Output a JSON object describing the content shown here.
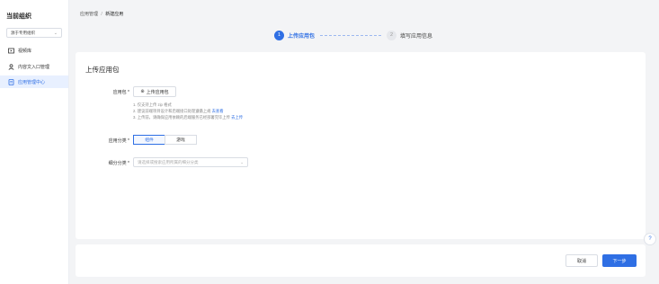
{
  "sidebar": {
    "title": "当前组织",
    "org_select": {
      "value": "源于专用组织",
      "icon": "chevron-down-icon"
    },
    "items": [
      {
        "label": "视频库",
        "icon": "video-library-icon",
        "active": false
      },
      {
        "label": "内容文入口管理",
        "icon": "user-group-icon",
        "active": false
      },
      {
        "label": "应用管理中心",
        "icon": "app-doc-icon",
        "active": true
      }
    ]
  },
  "breadcrumb": {
    "parent": "应用管理",
    "separator": "/",
    "current": "新建应用"
  },
  "steps": [
    {
      "number": "1",
      "label": "上传应用包",
      "state": "active"
    },
    {
      "number": "2",
      "label": "填写应用信息",
      "state": "inactive"
    }
  ],
  "form": {
    "title": "上传应用包",
    "package_label": "应用包 *",
    "upload_button": "上传应用包",
    "hints": {
      "h1": "1. 仅支持上传 zip 格式",
      "h2_text": "2. 建议前端项目设计和后端接口处理遵循上规",
      "h2_link": "去查看",
      "h3_text": "3. 上传前，请确保应用依赖的后端服务已经部署完毕上传",
      "h3_link": "去上传"
    },
    "category_label": "应用分类 *",
    "category_options": [
      "组件",
      "游戏"
    ],
    "category_selected": "组件",
    "subcategory_label": "细分分类 *",
    "subcategory_placeholder": "请选择或搜索应用所属的细分分类"
  },
  "footer": {
    "cancel": "取消",
    "next": "下一步"
  },
  "colors": {
    "accent": "#2f6fe4",
    "background": "#f3f4f6"
  }
}
